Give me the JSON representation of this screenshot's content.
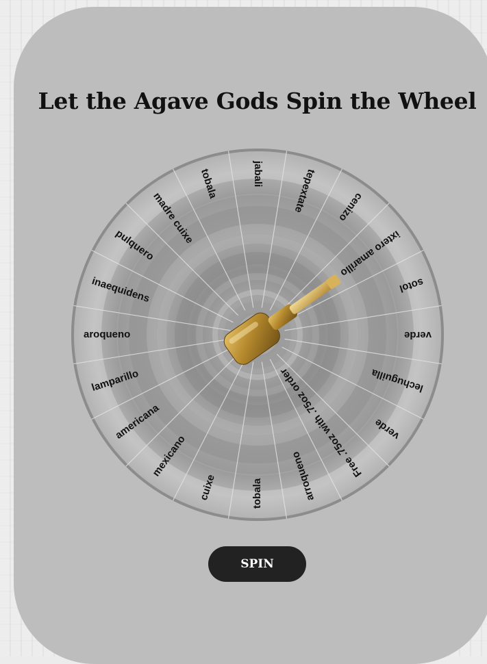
{
  "page": {
    "title": "Let the Agave Gods Spin the Wheel"
  },
  "wheel": {
    "segments": [
      "jabali",
      "tepextate",
      "cenizo",
      "ixtero amarillo",
      "sotol",
      "verde",
      "lechuguilla",
      "verde",
      "Free .75oz with .75oz order",
      "arroqueno",
      "tobala",
      "cuixe",
      "mexicano",
      "americana",
      "lamparillo",
      "aroqueno",
      "inaequidens",
      "pulquero",
      "madre cuixe",
      "tobala"
    ],
    "pointer_icon": "mezcal-bottle-icon"
  },
  "controls": {
    "spin_label": "SPIN"
  },
  "colors": {
    "card": "#bdbdbd",
    "button": "#222222",
    "wheel_ring": "#9c9c9c"
  }
}
